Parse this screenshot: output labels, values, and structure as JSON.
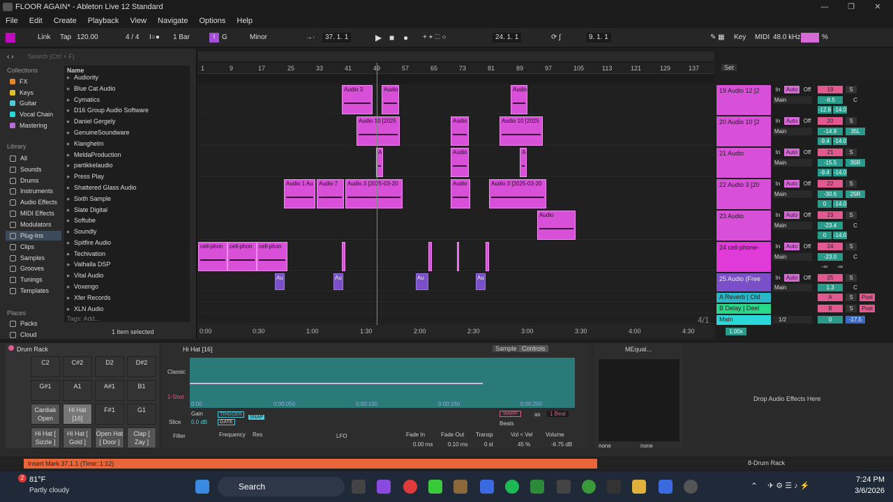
{
  "titlebar": {
    "title": "FLOOR AGAIN* - Ableton Live 12 Standard",
    "minimize": "—",
    "maximize": "❐",
    "close": "✕"
  },
  "menu": [
    "File",
    "Edit",
    "Create",
    "Playback",
    "View",
    "Navigate",
    "Options",
    "Help"
  ],
  "control": {
    "link": "Link",
    "tap": "Tap",
    "tempo": "120.00",
    "signature": "4 / 4",
    "quantize": "1 Bar",
    "key": "G",
    "scale": "Minor",
    "position": "37.  1.  1",
    "loop_start": "24.  1.  1",
    "loop_len": "9.  1.  1",
    "key_label": "Key",
    "midi_label": "MIDI",
    "sample_rate": "48.0 kHz",
    "cpu": "%"
  },
  "browser": {
    "search_placeholder": "Search (Ctrl + F)",
    "collections_title": "Collections",
    "collections": [
      {
        "label": "FX",
        "color": "#e08a2a"
      },
      {
        "label": "Keys",
        "color": "#e0c02a"
      },
      {
        "label": "Guitar",
        "color": "#4fc9d8"
      },
      {
        "label": "Vocal Chain",
        "color": "#2ad8d8"
      },
      {
        "label": "Mastering",
        "color": "#b86ad8"
      }
    ],
    "library_title": "Library",
    "library": [
      "All",
      "Sounds",
      "Drums",
      "Instruments",
      "Audio Effects",
      "MIDI Effects",
      "Modulators",
      "Plug-Ins",
      "Clips",
      "Samples",
      "Grooves",
      "Tunings",
      "Templates"
    ],
    "places_title": "Places",
    "places": [
      "Packs",
      "Cloud"
    ],
    "name_header": "Name",
    "items": [
      "Audiority",
      "Blue Cat Audio",
      "Cymatics",
      "D16 Group Audio Software",
      "Daniel Gergely",
      "GenuineSoundware",
      "Klanghelm",
      "MeldaProduction",
      "partikkelaudio",
      "Press Play",
      "Shattered Glass Audio",
      "Sixth Sample",
      "Slate Digital",
      "Softube",
      "Soundly",
      "Spitfire Audio",
      "Techivation",
      "Valhalla DSP",
      "Vital Audio",
      "Voxengo",
      "Xfer Records",
      "XLN Audio"
    ],
    "tags": "Tags:  Add...",
    "selected": "1 item selected"
  },
  "ruler": [
    "1",
    "9",
    "17",
    "25",
    "33",
    "41",
    "49",
    "57",
    "65",
    "73",
    "81",
    "89",
    "97",
    "105",
    "113",
    "121",
    "129",
    "137"
  ],
  "time_ruler": [
    "0:00",
    "0:30",
    "1:00",
    "1:30",
    "2:00",
    "2:30",
    "3:00",
    "3:30",
    "4:00",
    "4:30"
  ],
  "signature_marker": "4/1",
  "set_label": "Set",
  "clips": {
    "c1": "Audio 3",
    "c2": "Audio",
    "c3": "Audio 10 [2025",
    "c4": "Audio",
    "c5": "Audio 1 Au",
    "c6": "Audio 7",
    "c7": "Audio 3 [2025-03-20",
    "c8": "Audio 3 [2025-03-20",
    "c9": "Audio",
    "c10": "cell-phon",
    "c11": "cell-phon",
    "c12": "cell-phon",
    "c13": "Au",
    "c14": "Au",
    "c15": "Au",
    "c16": "Au",
    "c17": "Audio 10 [2025",
    "c18": "Audio",
    "c19": "Audio",
    "c20": "A",
    "c21": "Audio"
  },
  "tracks": [
    {
      "name": "19 Audio 12 [2",
      "num": "19",
      "vol": "-6.5",
      "pan": "C",
      "peak1": "-12.8",
      "peak2": "-14.0"
    },
    {
      "name": "20 Audio 10 [2",
      "num": "20",
      "vol": "-14.9",
      "pan": "35L",
      "peak1": "-9.4",
      "peak2": "-14.0"
    },
    {
      "name": "21 Audio",
      "num": "21",
      "vol": "-15.5",
      "pan": "35R",
      "peak1": "-9.4",
      "peak2": "-14.0"
    },
    {
      "name": "22 Audio 3 [20",
      "num": "22",
      "vol": "-30.6",
      "pan": "25R",
      "peak1": "0",
      "peak2": "-14.0"
    },
    {
      "name": "23 Audio",
      "num": "23",
      "vol": "-23.4",
      "pan": "C",
      "peak1": "0",
      "peak2": "-14.0"
    },
    {
      "name": "24 cell-phone-",
      "num": "24",
      "vol": "-23.0",
      "pan": "C",
      "peak1": "-∞",
      "peak2": "-∞"
    },
    {
      "name": "25 Audio (Free",
      "num": "25",
      "vol": "1.3",
      "pan": "C",
      "peak1": "",
      "peak2": ""
    }
  ],
  "mixer_labels": {
    "in": "In",
    "auto": "Auto",
    "off": "Off",
    "main": "Main",
    "s": "S",
    "post": "Post"
  },
  "returns": [
    {
      "name": "A Reverb | Old",
      "letter": "A"
    },
    {
      "name": "B Delay | Deel",
      "letter": "B"
    }
  ],
  "main_track": {
    "name": "Main",
    "value": "1/2",
    "vol": "0",
    "peak": "-17.5",
    "zoom": "1.00x"
  },
  "devices": {
    "drum_rack": "Drum Rack",
    "pads": [
      "C2",
      "C#2",
      "D2",
      "D#2",
      "G#1",
      "A1",
      "A#1",
      "B1",
      "Cardiak Open",
      "Hi Hat [16]",
      "F#1",
      "G1",
      "Hi Hat [ Sizzle ]",
      "Hi Hat [ Gold ]",
      "Open Hat [ Door ]",
      "Clap [ Zay ]"
    ],
    "simpler_title": "Hi Hat [16]",
    "sample_tab": "Sample",
    "controls_tab": "Controls",
    "modes": [
      "Classic",
      "1-Shot",
      "Slice"
    ],
    "gain_label": "Gain",
    "gain": "0.0 dB",
    "trigger": "TRIGGER",
    "gate": "GATE",
    "snap": "SNAP",
    "warp": "WARP",
    "as": "as",
    "beat": "1 Beat",
    "beats": "Beats",
    "times": [
      "0:00",
      "0:00:050",
      "0:00:100",
      "0:00:150",
      "0:00:200"
    ],
    "filter": "Filter",
    "frequency": "Frequency",
    "res": "Res",
    "lfo": "LFO",
    "fade_in": "Fade In",
    "fade_in_val": "0.00 ms",
    "fade_out": "Fade Out",
    "fade_out_val": "0.10 ms",
    "transp": "Transp",
    "transp_val": "0 st",
    "vol_vel": "Vol < Vel",
    "vol_vel_val": "45 %",
    "volume": "Volume",
    "volume_val": "-6.75 dB",
    "meq": "MEqual...",
    "none1": "none",
    "none2": "none",
    "drop": "Drop Audio Effects Here"
  },
  "status": {
    "text": "Insert Mark 37.1.1 (Time: 1:12)",
    "track": "8-Drum Rack"
  },
  "taskbar": {
    "weather_temp": "81°F",
    "weather_desc": "Partly cloudy",
    "weather_badge": "2",
    "search": "Search",
    "time": "7:24 PM",
    "date": "3/6/2026"
  }
}
